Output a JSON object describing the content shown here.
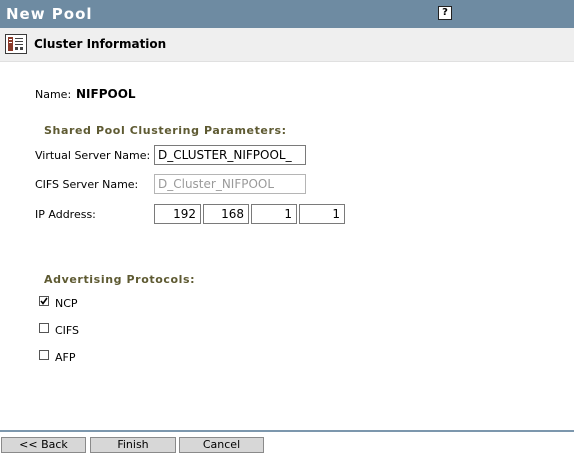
{
  "window": {
    "title": "New Pool",
    "help_label": "?"
  },
  "header": {
    "title": "Cluster Information",
    "icon": "cluster-info-icon"
  },
  "form": {
    "name_label": "Name:",
    "name_value": "NIFPOOL",
    "section_clustering": "Shared Pool Clustering Parameters:",
    "virtual_server_label": "Virtual Server Name:",
    "virtual_server_value": "D_CLUSTER_NIFPOOL_",
    "cifs_server_label": "CIFS Server Name:",
    "cifs_server_value": "D_Cluster_NIFPOOL",
    "ip_label": "IP Address:",
    "ip_octets": [
      "192",
      "168",
      "1",
      "1"
    ],
    "section_protocols": "Advertising Protocols:",
    "protocols": [
      {
        "label": "NCP",
        "checked": true
      },
      {
        "label": "CIFS",
        "checked": false
      },
      {
        "label": "AFP",
        "checked": false
      }
    ]
  },
  "buttons": {
    "back": "<< Back",
    "finish": "Finish",
    "cancel": "Cancel"
  }
}
